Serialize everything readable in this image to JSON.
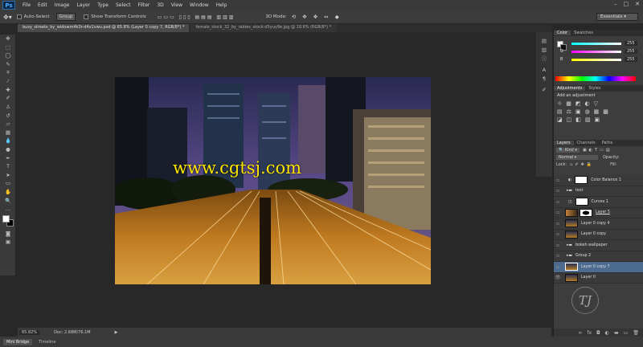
{
  "menubar": {
    "logo": "Ps",
    "items": [
      "File",
      "Edit",
      "Image",
      "Layer",
      "Type",
      "Select",
      "Filter",
      "3D",
      "View",
      "Window",
      "Help"
    ],
    "window_controls": [
      "–",
      "□",
      "✕"
    ]
  },
  "options": {
    "auto_select_label": "Auto-Select",
    "group_value": "Group",
    "show_transform_label": "Show Transform Controls",
    "mode_label": "3D Mode:",
    "workspace": "Essentials"
  },
  "tabs": [
    {
      "label": "busy_streets_by_widowm4k3r-d4x1vwu.psd @ 65.8% (Layer 0 copy 7, RGB/8*) *",
      "active": true
    },
    {
      "label": "female_stock_32_by_rabies_stock-d5yuy9e.jpg @ 19.6% (RGB/8*) *",
      "active": false
    }
  ],
  "watermark": "www.cgtsj.com",
  "status": {
    "zoom": "65.82%",
    "doc": "Doc: 2.68M/76.1M"
  },
  "bottom_tabs": [
    {
      "label": "Mini Bridge",
      "active": true
    },
    {
      "label": "Timeline",
      "active": false
    }
  ],
  "color_panel": {
    "tabs": [
      "Color",
      "Swatches"
    ],
    "channels": [
      {
        "label": "R",
        "value": "255"
      },
      {
        "label": "G",
        "value": "255"
      },
      {
        "label": "B",
        "value": "255"
      }
    ]
  },
  "adjustments_panel": {
    "tabs": [
      "Adjustments",
      "Styles"
    ],
    "title": "Add an adjustment"
  },
  "layers_panel": {
    "tabs": [
      "Layers",
      "Channels",
      "Paths"
    ],
    "kind_label": "Kind",
    "blend_mode": "Normal",
    "opacity_label": "Opacity:",
    "lock_label": "Lock:",
    "fill_label": "Fill:",
    "layers": [
      {
        "name": "Color Balance 1",
        "type": "adjustment",
        "selected": false
      },
      {
        "name": "text",
        "type": "group",
        "selected": false
      },
      {
        "name": "Curves 1",
        "type": "adjustment",
        "selected": false
      },
      {
        "name": "Layer 5",
        "type": "masked",
        "selected": false
      },
      {
        "name": "Layer 0 copy 4",
        "type": "image",
        "selected": false
      },
      {
        "name": "Layer 0 copy",
        "type": "image",
        "selected": false
      },
      {
        "name": "bokeh wallpaper",
        "type": "group",
        "selected": false
      },
      {
        "name": "Group 2",
        "type": "group",
        "selected": false
      },
      {
        "name": "Layer 0 copy 7",
        "type": "image",
        "selected": true
      },
      {
        "name": "Layer 0",
        "type": "image",
        "selected": false
      }
    ]
  },
  "corner_logo": "TJ",
  "icons": [
    "move-icon",
    "marquee-icon",
    "lasso-icon",
    "quick-select-icon",
    "crop-icon",
    "eyedropper-icon",
    "healing-icon",
    "brush-icon",
    "clone-stamp-icon",
    "history-brush-icon",
    "eraser-icon",
    "gradient-icon",
    "blur-icon",
    "dodge-icon",
    "pen-icon",
    "type-icon",
    "path-select-icon",
    "shape-icon",
    "hand-icon",
    "zoom-icon"
  ]
}
